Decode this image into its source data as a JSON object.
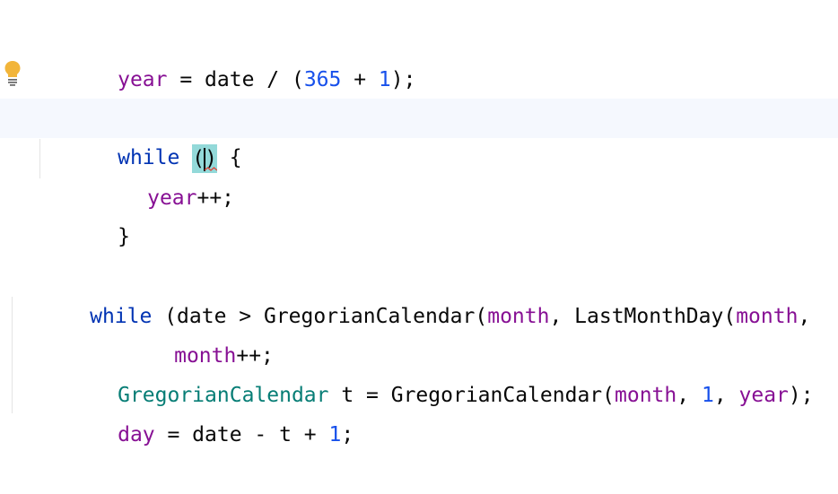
{
  "editor": {
    "lines": {
      "year_assign": {
        "var": "year",
        "op1": " = date / (",
        "n1": "365",
        "op2": " + ",
        "n2": "1",
        "end": ");"
      },
      "inner_while": {
        "kw": "while",
        "sp": " ",
        "open": "(",
        "close": ")",
        "brace": " {"
      },
      "year_inc": {
        "var": "year",
        "op": "++;"
      },
      "close_brace": {
        "text": "}"
      },
      "outer_while": {
        "kw": "while",
        "a": " (date > GregorianCalendar(",
        "v1": "month",
        "b": ", LastMonthDay(",
        "v2": "month",
        "c": ","
      },
      "month_inc": {
        "var": "month",
        "op": "++;"
      },
      "calendar_decl": {
        "type": "GregorianCalendar",
        "a": " t = GregorianCalendar(",
        "v1": "month",
        "b": ", ",
        "n1": "1",
        "c": ", ",
        "v2": "year",
        "d": ");"
      },
      "day_assign": {
        "var": "day",
        "a": " = date - t + ",
        "n1": "1",
        "b": ";"
      }
    },
    "colors": {
      "keyword": "#0033b3",
      "variable": "#871094",
      "number": "#1750eb",
      "type": "#067d75",
      "current_line": "#f5f8fe",
      "paren_highlight": "#93d9d9",
      "bulb": "#f2b53a",
      "error_squiggle": "#e0463c"
    },
    "gutter": {
      "intention_icon": "lightbulb-icon"
    }
  }
}
